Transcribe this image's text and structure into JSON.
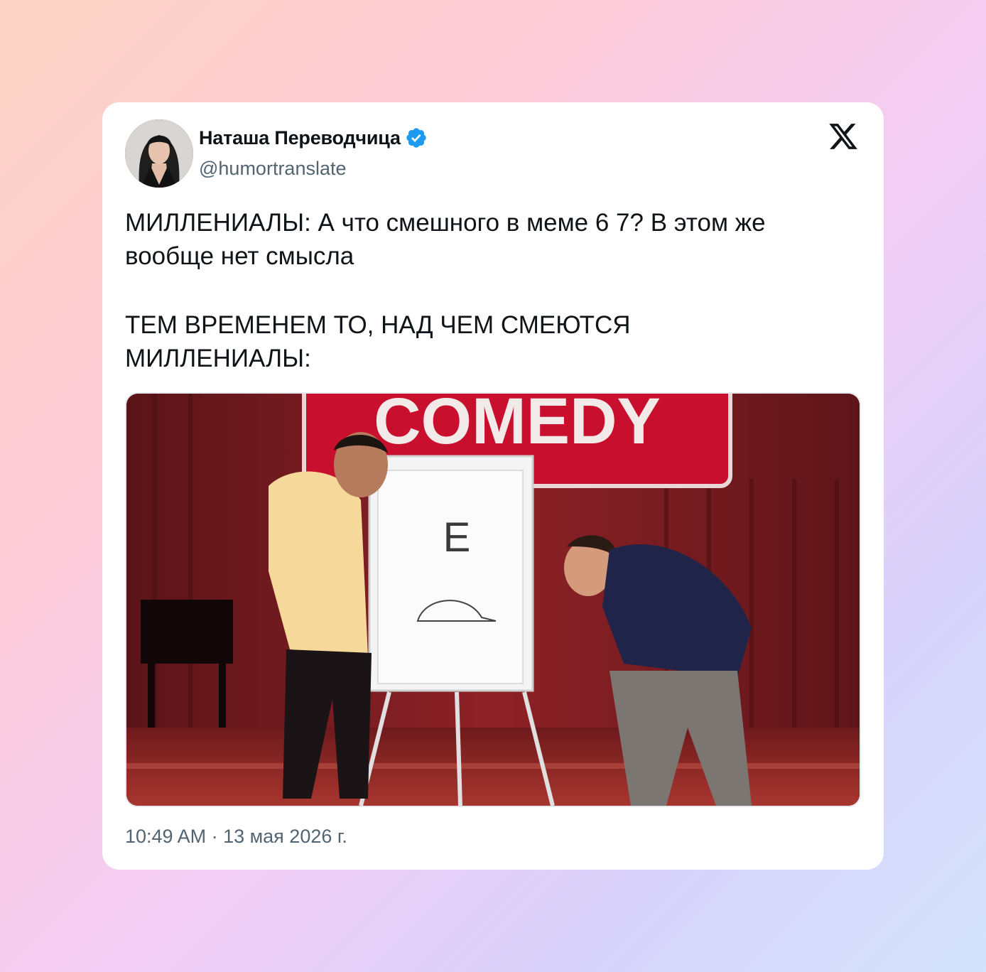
{
  "tweet": {
    "author_name": "Наташа Переводчица",
    "handle": "@humortranslate",
    "verified": true,
    "text_lines": [
      "МИЛЛЕНИАЛЫ: А что смешного в меме 6 7? В этом же",
      "вообще нет смысла",
      "ТЕМ ВРЕМЕНЕМ ТО, НАД ЧЕМ СМЕЮТСЯ",
      "МИЛЛЕНИАЛЫ:"
    ],
    "timestamp": "10:49 AM · 13 мая 2026 г."
  },
  "media": {
    "sign_text": "COMEDY",
    "board_letter": "Е"
  },
  "colors": {
    "verified_blue": "#1d9bf0",
    "text_primary": "#0f1419",
    "text_secondary": "#536471",
    "stage_red": "#8a1d22"
  },
  "icons": {
    "logo": "x-logo-icon",
    "badge": "verified-badge-icon"
  }
}
